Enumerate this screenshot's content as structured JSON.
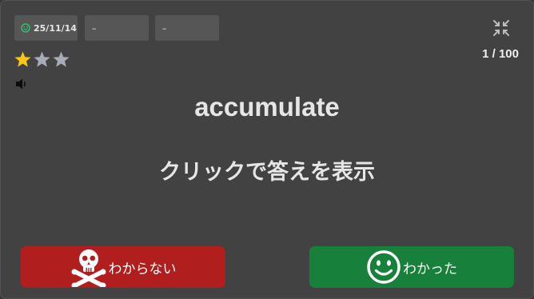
{
  "header": {
    "date": "25/11/14",
    "field_a": "–",
    "field_b": "–",
    "counter": "1 / 100"
  },
  "rating": {
    "value": 1,
    "max": 3
  },
  "card": {
    "word": "accumulate",
    "reveal_prompt": "クリックで答えを表示"
  },
  "buttons": {
    "unknown_label": "わからない",
    "known_label": "わかった"
  },
  "colors": {
    "background": "#424242",
    "chip": "#565656",
    "star_on": "#f5c518",
    "star_off": "#a7abb5",
    "unknown_button": "#b01e1e",
    "known_button": "#17803a",
    "smile_icon": "#2ecc71"
  },
  "icons": {
    "date": "smile-icon",
    "fullscreen": "compress-icon",
    "audio": "speaker-icon",
    "unknown": "skull-crossbones-icon",
    "known": "smile-icon"
  }
}
